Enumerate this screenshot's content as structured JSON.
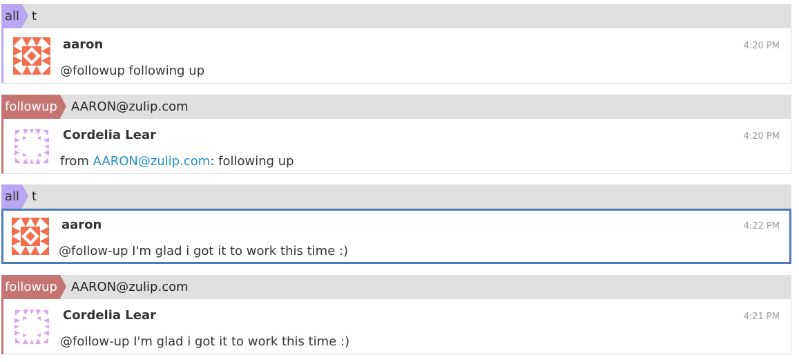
{
  "groups": [
    {
      "stream": "all",
      "topic": "t",
      "message": {
        "sender": "aaron",
        "time": "4:20 PM",
        "content": "@followup following up",
        "avatar_icon": "aaron-identicon"
      }
    },
    {
      "stream": "followup",
      "topic": "AARON@zulip.com",
      "message": {
        "sender": "Cordelia Lear",
        "time": "4:20 PM",
        "content_prefix": "from ",
        "content_link": "AARON@zulip.com",
        "content_suffix": ": following up",
        "avatar_icon": "cordelia-identicon"
      }
    },
    {
      "stream": "all",
      "topic": "t",
      "message": {
        "sender": "aaron",
        "time": "4:22 PM",
        "content": "@follow-up I'm glad i got it to work this time :)",
        "avatar_icon": "aaron-identicon",
        "selected": true
      }
    },
    {
      "stream": "followup",
      "topic": "AARON@zulip.com",
      "message": {
        "sender": "Cordelia Lear",
        "time": "4:21 PM",
        "content": "@follow-up I'm glad i got it to work this time :)",
        "avatar_icon": "cordelia-identicon"
      }
    }
  ],
  "colors": {
    "stream_all": "#b9a7f2",
    "stream_followup": "#c57571",
    "selected_border": "#4d7ab8",
    "link": "#1d8fc7",
    "aaron_avatar": "#f26e4c",
    "cordelia_avatar": "#d9a6ee"
  }
}
